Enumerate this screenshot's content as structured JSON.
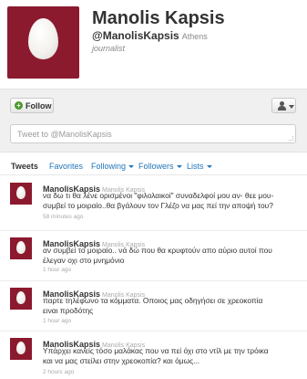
{
  "profile": {
    "name": "Manolis Kapsis",
    "screen_name": "@ManolisKapsis",
    "location": "Athens",
    "bio": "journalist",
    "avatar_color": "#8b1a2e"
  },
  "actions": {
    "follow_label": "Follow",
    "tweet_placeholder": "Tweet to @ManolisKapsis"
  },
  "tabs": [
    {
      "label": "Tweets"
    },
    {
      "label": "Favorites"
    },
    {
      "label": "Following"
    },
    {
      "label": "Followers"
    },
    {
      "label": "Lists"
    }
  ],
  "tweets": [
    {
      "name": "ManolisKapsis",
      "handle": "Manolis Kapsis",
      "lines": [
        "να δω τι θα λένε ορισμένοι \"φιλολαικοί\" συναδελφοί μου αν- θεε μου-",
        "συμβεί το μοιραίο..θα βγάλουν τον Γλέζο να μας πεί την αποψή του?"
      ],
      "time": "58 minutes ago"
    },
    {
      "name": "ManolisKapsis",
      "handle": "Manolis Kapsis",
      "lines": [
        "αν συμβεί το μοιραίο.. νά δώ που θα κρυφτούν απο αύριο αυτοί που",
        "έλεγαν οχι στο μνημόνιο"
      ],
      "time": "1 hour ago"
    },
    {
      "name": "ManolisKapsis",
      "handle": "Manolis Kapsis",
      "lines": [
        "παρτε τηλέφωνο τα κόμματα. Οποιος μας οδηγήσει σε χρεοκοπία",
        "ειναι προδότης"
      ],
      "time": "1 hour ago"
    },
    {
      "name": "ManolisKapsis",
      "handle": "Manolis Kapsis",
      "lines": [
        "Υπάρχει κανείς τόσο μαλάκας που να πεί όχι στο ντίλ με την τρόικα",
        "και να μας στείλει στην χρεοκοπία? και όμως..."
      ],
      "time": "2 hours ago"
    }
  ]
}
